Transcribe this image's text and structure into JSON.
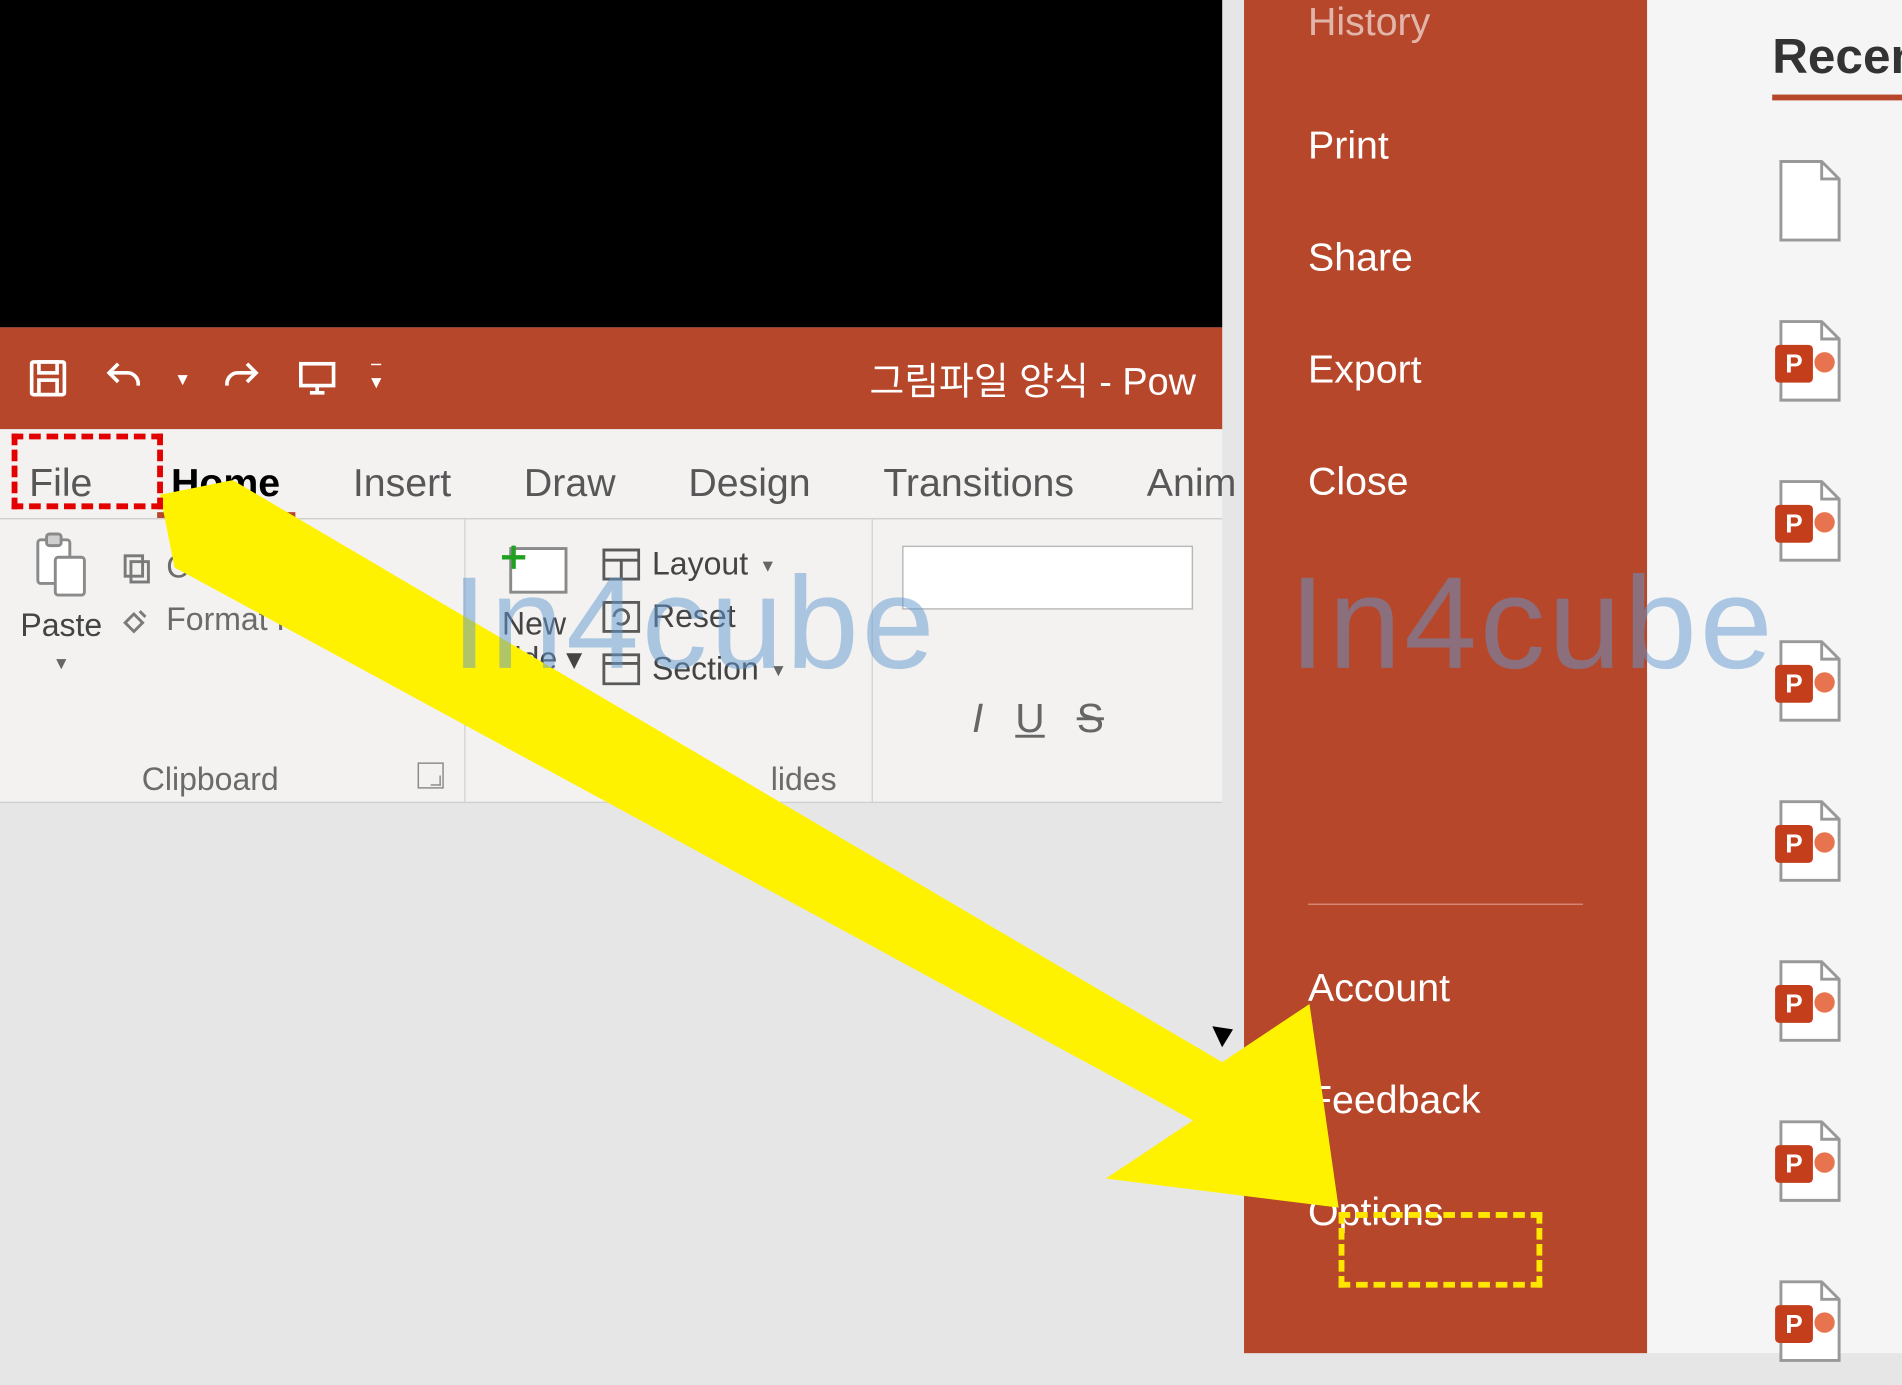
{
  "titlebar": {
    "doc_title": "그림파일 양식 - Pow"
  },
  "qat_icons": {
    "save": "save-icon",
    "undo": "undo-icon",
    "redo": "redo-icon",
    "present": "present-icon",
    "more": "▾"
  },
  "tabs": {
    "file": "File",
    "home": "Home",
    "insert": "Insert",
    "draw": "Draw",
    "design": "Design",
    "transitions": "Transitions",
    "animations": "Anim"
  },
  "ribbon": {
    "clipboard": {
      "paste": "Paste",
      "copy": "Cop",
      "format_painter": "Format Pai",
      "group_label": "Clipboard"
    },
    "slides": {
      "new_slide_line1": "New",
      "new_slide_line2": "Slide",
      "layout": "Layout",
      "reset": "Reset",
      "section": "Section",
      "group_label_fragment": "lides"
    },
    "font": {
      "italic": "I",
      "underline": "U",
      "strike": "S"
    }
  },
  "backstage": {
    "history": "History",
    "print": "Print",
    "share": "Share",
    "export": "Export",
    "close": "Close",
    "account": "Account",
    "feedback": "Feedback",
    "options": "Options"
  },
  "recent_panel": {
    "heading": "Recent"
  },
  "watermark": "In4cube"
}
